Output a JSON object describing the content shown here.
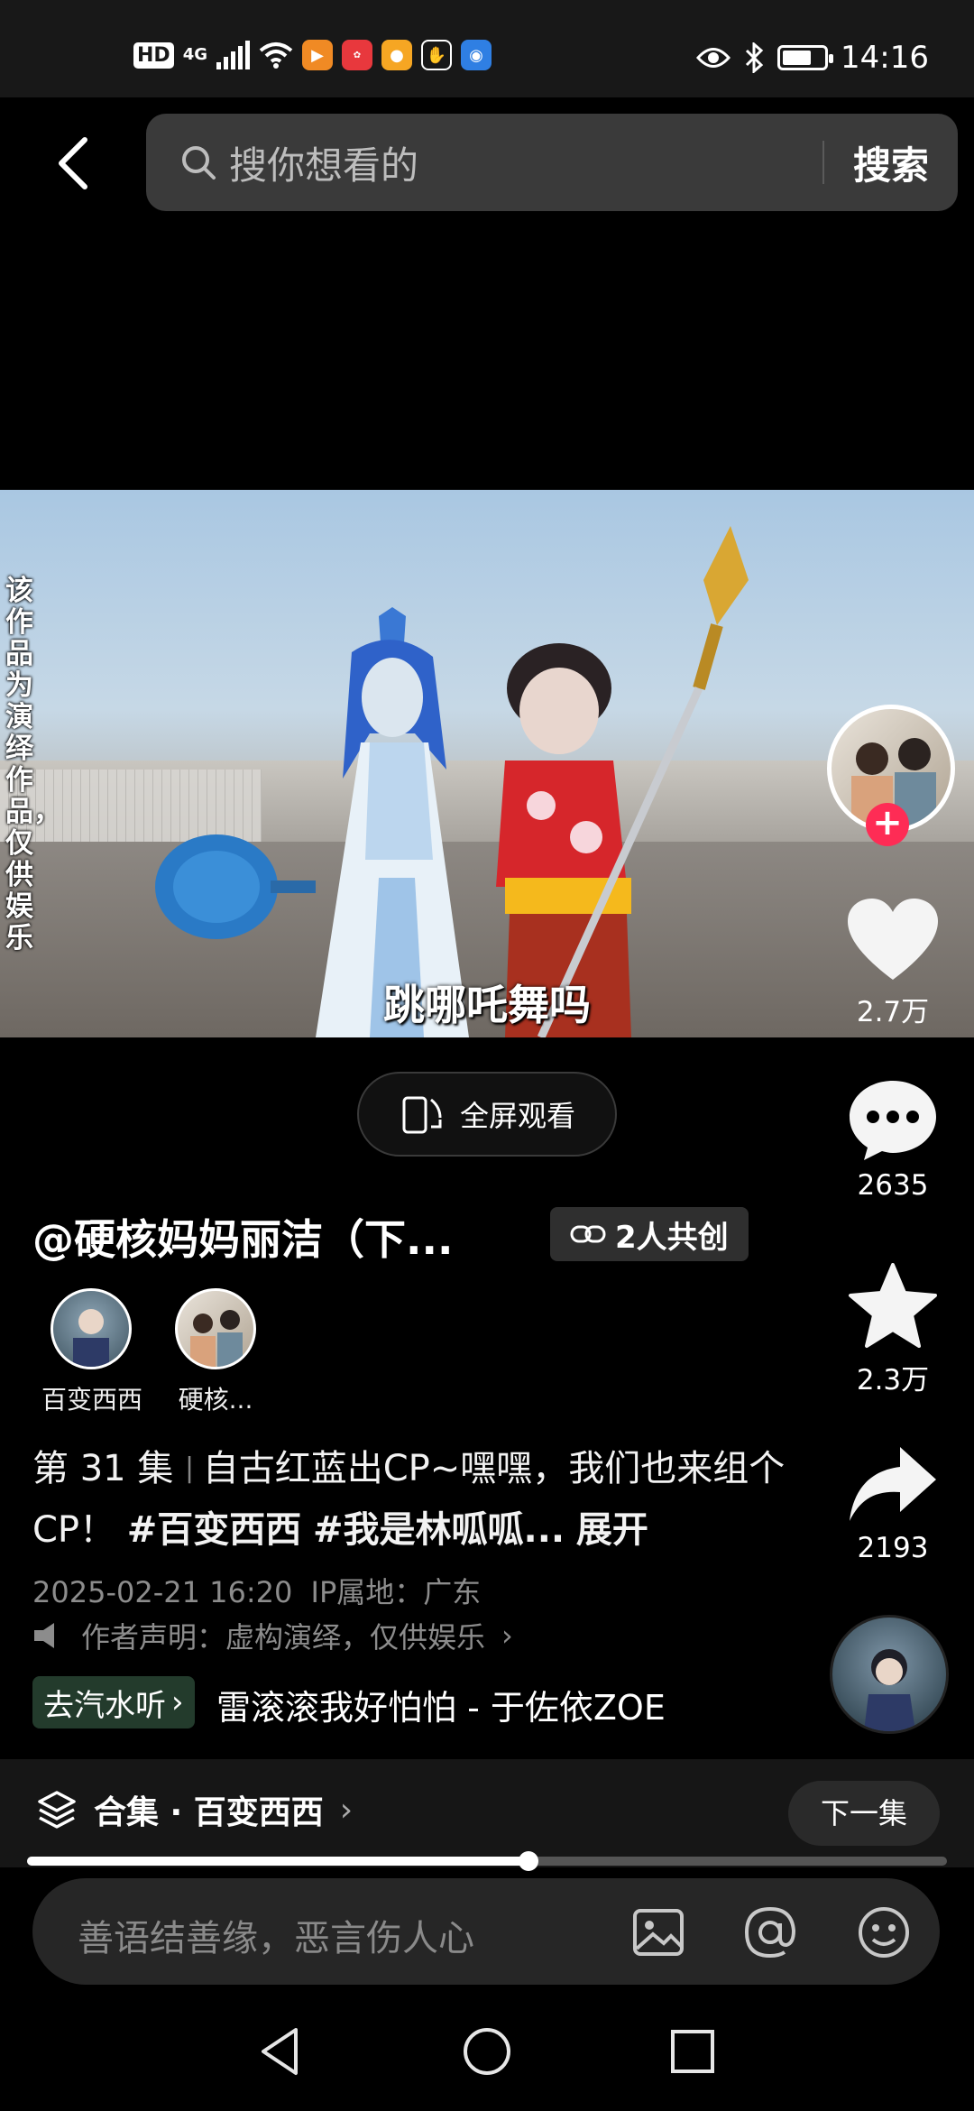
{
  "status_bar": {
    "hd": "HD",
    "network": "4G",
    "time": "14:16",
    "battery_level": 0.7
  },
  "search": {
    "placeholder": "搜你想看的",
    "button": "搜索"
  },
  "video": {
    "vertical_notice": "该作品为演绎作品，仅供娱乐",
    "subtitle": "跳哪吒舞吗"
  },
  "actions": {
    "likes": "2.7万",
    "comments": "2635",
    "favorites": "2.3万",
    "shares": "2193"
  },
  "fullscreen": {
    "label": "全屏观看"
  },
  "author": {
    "name": "@硬核妈妈丽洁（下...",
    "cocreate_label": "2人共创",
    "creators": [
      {
        "name": "百变西西"
      },
      {
        "name": "硬核..."
      }
    ]
  },
  "description": {
    "episode": "第 31 集",
    "text": "自古红蓝出CP~嘿嘿，我们也来组个CP！",
    "tag1": "#百变西西",
    "tag2": "#我是林呱呱...",
    "expand": "展开",
    "datetime": "2025-02-21 16:20",
    "ip_label": "IP属地：广东",
    "claim": "作者声明：虚构演绎，仅供娱乐"
  },
  "music": {
    "chip": "去汽水听",
    "title": "雷滚滚我好怕怕 - 于佐依ZOE"
  },
  "collection": {
    "label": "合集 · 百变西西",
    "next": "下一集"
  },
  "progress": {
    "fraction": 0.545
  },
  "comment": {
    "placeholder": "善语结善缘，恶言伤人心"
  },
  "colors": {
    "accent_red": "#fe2c55",
    "music_chip_bg": "#233b2c"
  }
}
